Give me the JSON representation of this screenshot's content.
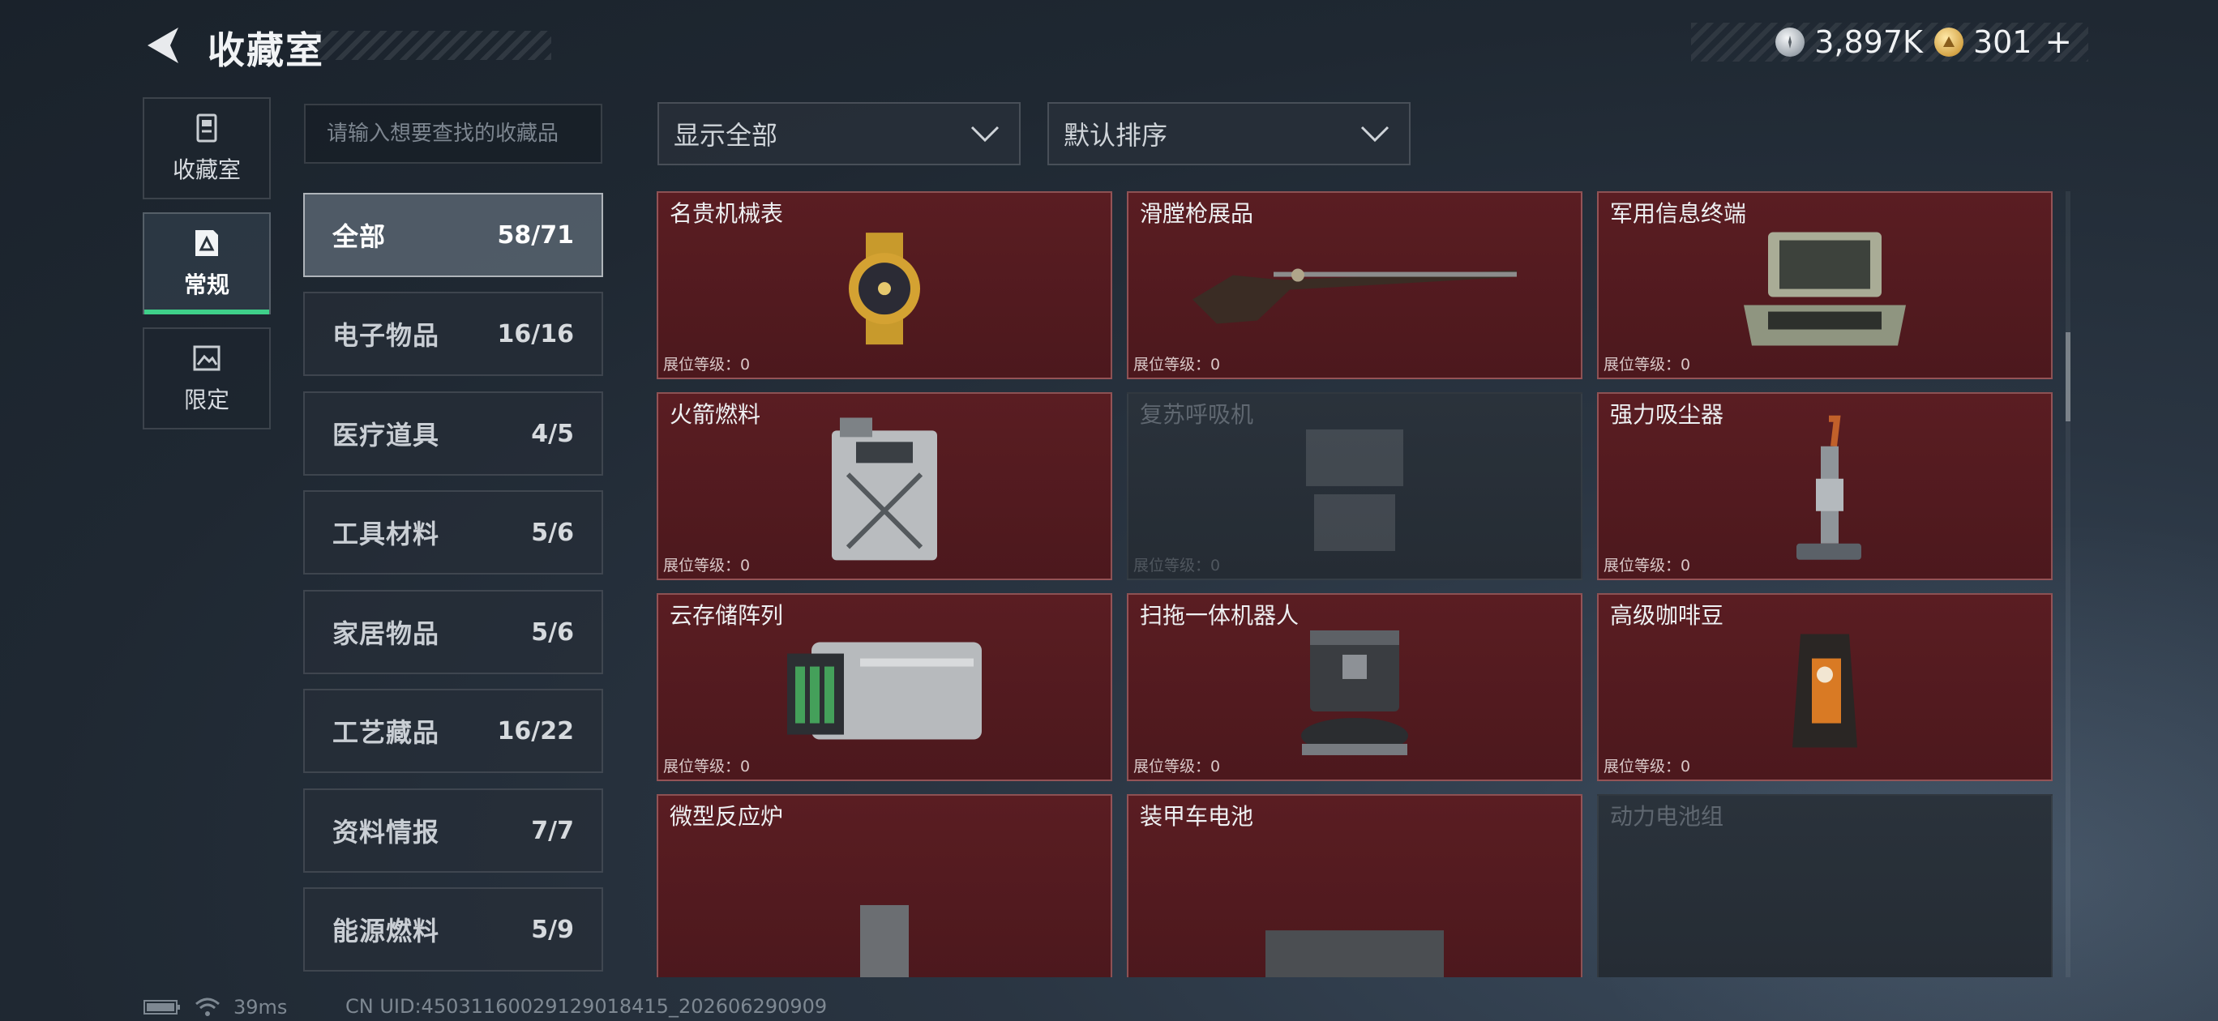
{
  "header": {
    "title": "收藏室"
  },
  "currency": [
    {
      "icon": "silver-coin-icon",
      "value": "3,897K"
    },
    {
      "icon": "gold-coin-icon",
      "value": "301"
    }
  ],
  "rail": [
    {
      "label": "收藏室",
      "icon": "trash-bin-icon",
      "active": false
    },
    {
      "label": "常规",
      "icon": "document-icon",
      "active": true
    },
    {
      "label": "限定",
      "icon": "picture-icon",
      "active": false
    }
  ],
  "search": {
    "placeholder": "请输入想要查找的收藏品"
  },
  "filters": {
    "show": "显示全部",
    "sort": "默认排序"
  },
  "categories": [
    {
      "name": "全部",
      "count": "58/71",
      "active": true
    },
    {
      "name": "电子物品",
      "count": "16/16"
    },
    {
      "name": "医疗道具",
      "count": "4/5"
    },
    {
      "name": "工具材料",
      "count": "5/6"
    },
    {
      "name": "家居物品",
      "count": "5/6"
    },
    {
      "name": "工艺藏品",
      "count": "16/22"
    },
    {
      "name": "资料情报",
      "count": "7/7"
    },
    {
      "name": "能源燃料",
      "count": "5/9"
    }
  ],
  "level_label": "展位等级：0",
  "items": [
    {
      "name": "",
      "art": "graphics-card",
      "locked": false
    },
    {
      "name": "",
      "art": "red-device",
      "locked": false
    },
    {
      "name": "",
      "art": "armored-vehicle",
      "locked": false
    },
    {
      "name": "名贵机械表",
      "art": "watch",
      "locked": false
    },
    {
      "name": "滑膛枪展品",
      "art": "musket",
      "locked": false
    },
    {
      "name": "军用信息终端",
      "art": "terminal-case",
      "locked": false
    },
    {
      "name": "火箭燃料",
      "art": "fuel-can",
      "locked": false
    },
    {
      "name": "复苏呼吸机",
      "art": "ventilator",
      "locked": true
    },
    {
      "name": "强力吸尘器",
      "art": "vacuum",
      "locked": false
    },
    {
      "name": "云存储阵列",
      "art": "storage-array",
      "locked": false
    },
    {
      "name": "扫拖一体机器人",
      "art": "robot-mop",
      "locked": false
    },
    {
      "name": "高级咖啡豆",
      "art": "coffee-bag",
      "locked": false
    },
    {
      "name": "微型反应炉",
      "art": "reactor",
      "locked": false
    },
    {
      "name": "装甲车电池",
      "art": "battery",
      "locked": false
    },
    {
      "name": "动力电池组",
      "art": "battery-pack",
      "locked": true
    }
  ],
  "footer": {
    "ping": "39ms",
    "uid": "CN UID:450311600291290184​15_202606290909"
  }
}
